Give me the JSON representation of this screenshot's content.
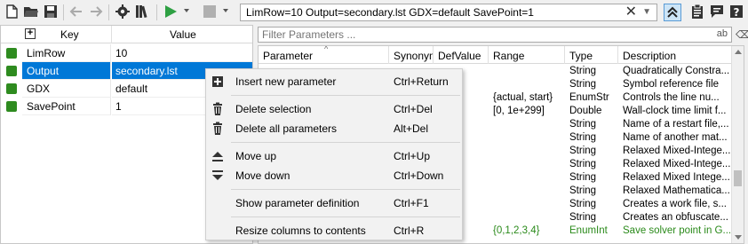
{
  "toolbar": {
    "icons": [
      "new-file-icon",
      "open-folder-icon",
      "save-icon",
      "back-arrow-icon",
      "forward-arrow-icon",
      "settings-gear-icon",
      "library-icon",
      "run-icon",
      "stop-icon"
    ],
    "command_line": "LimRow=10 Output=secondary.lst GDX=default SavePoint=1",
    "right_icons": [
      "clear-icon",
      "dropdown-icon",
      "collapse-icon",
      "clipboard-icon",
      "comment-icon",
      "help-icon"
    ]
  },
  "left_table": {
    "headers": {
      "key": "Key",
      "value": "Value"
    },
    "rows": [
      {
        "key": "LimRow",
        "value": "10"
      },
      {
        "key": "Output",
        "value": "secondary.lst"
      },
      {
        "key": "GDX",
        "value": "default"
      },
      {
        "key": "SavePoint",
        "value": "1"
      }
    ],
    "selected_row": 1
  },
  "filter": {
    "placeholder": "Filter Parameters ...",
    "ab_label": "ab"
  },
  "param_table": {
    "headers": [
      "Parameter",
      "Synonym",
      "DefValue",
      "Range",
      "Type",
      "Description"
    ],
    "rows": [
      {
        "parameter": "",
        "synonym": "",
        "defvalue": "",
        "range": "",
        "type": "String",
        "description": "Quadratically Constra...",
        "highlight": false
      },
      {
        "parameter": "",
        "synonym": "",
        "defvalue": "",
        "range": "",
        "type": "String",
        "description": "Symbol reference file",
        "highlight": false
      },
      {
        "parameter": "",
        "synonym": "",
        "defvalue": "",
        "range": "{actual, start}",
        "type": "EnumStr",
        "description": "Controls the line nu...",
        "highlight": false
      },
      {
        "parameter": "",
        "synonym": "",
        "defvalue": "",
        "range": "[0, 1e+299]",
        "type": "Double",
        "description": "Wall-clock time limit f...",
        "highlight": false
      },
      {
        "parameter": "",
        "synonym": "",
        "defvalue": "",
        "range": "",
        "type": "String",
        "description": "Name of a restart file,...",
        "highlight": false
      },
      {
        "parameter": "",
        "synonym": "",
        "defvalue": "",
        "range": "",
        "type": "String",
        "description": "Name of another mat...",
        "highlight": false
      },
      {
        "parameter": "",
        "synonym": "",
        "defvalue": "",
        "range": "",
        "type": "String",
        "description": "Relaxed Mixed-Intege...",
        "highlight": false
      },
      {
        "parameter": "",
        "synonym": "",
        "defvalue": "",
        "range": "",
        "type": "String",
        "description": "Relaxed Mixed-Intege...",
        "highlight": false
      },
      {
        "parameter": "",
        "synonym": "",
        "defvalue": "",
        "range": "",
        "type": "String",
        "description": "Relaxed Mixed Intege...",
        "highlight": false
      },
      {
        "parameter": "",
        "synonym": "",
        "defvalue": "",
        "range": "",
        "type": "String",
        "description": "Relaxed Mathematica...",
        "highlight": false
      },
      {
        "parameter": "",
        "synonym": "",
        "defvalue": "",
        "range": "",
        "type": "String",
        "description": "Creates a work file, s...",
        "highlight": false
      },
      {
        "parameter": "",
        "synonym": "",
        "defvalue": "",
        "range": "",
        "type": "String",
        "description": "Creates an obfuscate...",
        "highlight": false
      },
      {
        "parameter": "",
        "synonym": "",
        "defvalue": "",
        "range": "{0,1,2,3,4}",
        "type": "EnumInt",
        "description": "Save solver point in G...",
        "highlight": true
      }
    ]
  },
  "context_menu": {
    "items": [
      {
        "label": "Insert new parameter",
        "shortcut": "Ctrl+Return",
        "icon": "insert-icon"
      },
      {
        "label": "Delete selection",
        "shortcut": "Ctrl+Del",
        "icon": "trash-icon"
      },
      {
        "label": "Delete all parameters",
        "shortcut": "Alt+Del",
        "icon": "trash-all-icon"
      },
      {
        "label": "Move up",
        "shortcut": "Ctrl+Up",
        "icon": "move-up-icon"
      },
      {
        "label": "Move down",
        "shortcut": "Ctrl+Down",
        "icon": "move-down-icon"
      },
      {
        "label": "Show parameter definition",
        "shortcut": "Ctrl+F1",
        "icon": ""
      },
      {
        "label": "Resize columns to contents",
        "shortcut": "Ctrl+R",
        "icon": ""
      }
    ]
  },
  "colors": {
    "accent": "#0078d7",
    "check_green": "#2e8b1f",
    "run_green": "#2ea043",
    "highlight_text": "#2a8a1a"
  }
}
